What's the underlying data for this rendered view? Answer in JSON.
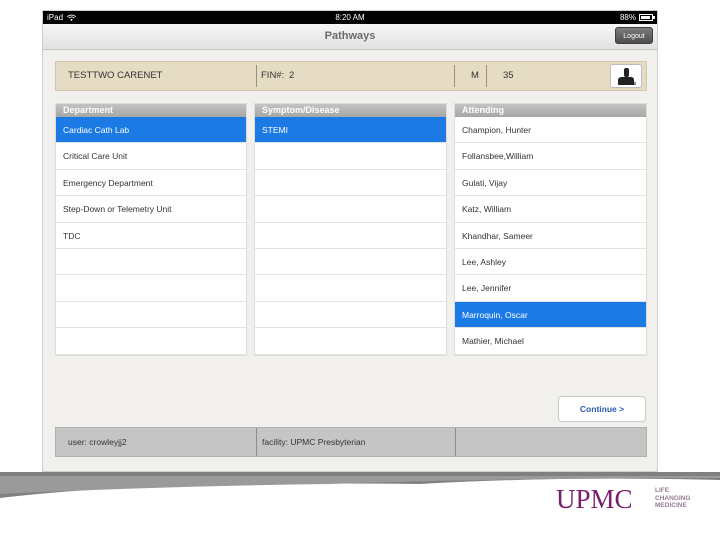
{
  "statusbar": {
    "carrier": "iPad",
    "time": "8:20 AM",
    "battery": "88%",
    "battery_level": 0.88
  },
  "navbar": {
    "title": "Pathways",
    "logout_label": "Logout"
  },
  "patient": {
    "name": "TESTTWO CARENET",
    "fin_label": "FIN#:",
    "fin": "2",
    "sex": "M",
    "age": "35"
  },
  "departments": {
    "header": "Department",
    "items": [
      "Cardiac Cath Lab",
      "Critical Care Unit",
      "Emergency Department",
      "Step-Down or Telemetry Unit",
      "TDC",
      "",
      "",
      "",
      ""
    ],
    "selected": "Cardiac Cath Lab"
  },
  "symptoms": {
    "header": "Symptom/Disease",
    "items": [
      "STEMI",
      "",
      "",
      "",
      "",
      "",
      "",
      "",
      ""
    ],
    "selected": "STEMI"
  },
  "attending": {
    "header": "Attending",
    "items": [
      "Champion, Hunter",
      "Follansbee,William",
      "Gulati, Vijay",
      "Katz, William",
      "Khandhar, Sameer",
      "Lee, Ashley",
      "Lee, Jennifer",
      "Marroquin, Oscar",
      "Mathier, Michael"
    ],
    "selected": "Marroquin, Oscar"
  },
  "continue_label": "Continue  >",
  "footer": {
    "user": "user: crowleyjj2",
    "facility": "facility: UPMC Presbyterian"
  },
  "brand": {
    "logo": "UPMC",
    "tagline_1": "LIFE",
    "tagline_2": "CHANGING",
    "tagline_3": "MEDICINE",
    "color": "#7a1f6e"
  },
  "colors": {
    "selection": "#1b7ae4",
    "header_gray": "#b0b0b0",
    "patient_bar": "#e6dcc4"
  }
}
